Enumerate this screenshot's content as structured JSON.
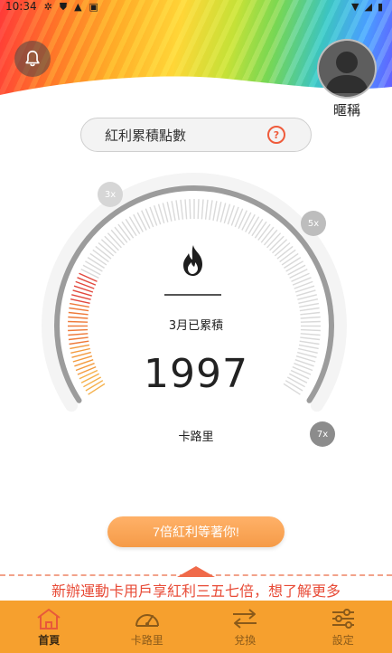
{
  "status_bar": {
    "time": "10:34",
    "left_icons": [
      "settings-icon",
      "shield-icon",
      "warning-icon",
      "clipboard-icon"
    ],
    "right_icons": [
      "wifi-icon",
      "signal-icon",
      "battery-icon"
    ]
  },
  "header": {
    "nickname": "暱稱"
  },
  "points_bar": {
    "label": "紅利累積點數",
    "help_symbol": "?"
  },
  "gauge": {
    "month_label": "3月已累積",
    "value": "1997",
    "unit": "卡路里",
    "multipliers": [
      "3x",
      "5x",
      "7x"
    ]
  },
  "cta": {
    "label": "7倍紅利等著你!"
  },
  "promo": {
    "text": "新辦運動卡用戶享紅利三五七倍，想了解更多"
  },
  "tabs": [
    {
      "label": "首頁",
      "icon": "home-icon",
      "active": true
    },
    {
      "label": "卡路里",
      "icon": "speedometer-icon",
      "active": false
    },
    {
      "label": "兌換",
      "icon": "exchange-icon",
      "active": false
    },
    {
      "label": "設定",
      "icon": "sliders-icon",
      "active": false
    }
  ],
  "colors": {
    "accent_orange": "#f6a02e",
    "cta_orange": "#f59b48",
    "promo_red": "#e84b37",
    "gauge_red": "#e2483d"
  }
}
